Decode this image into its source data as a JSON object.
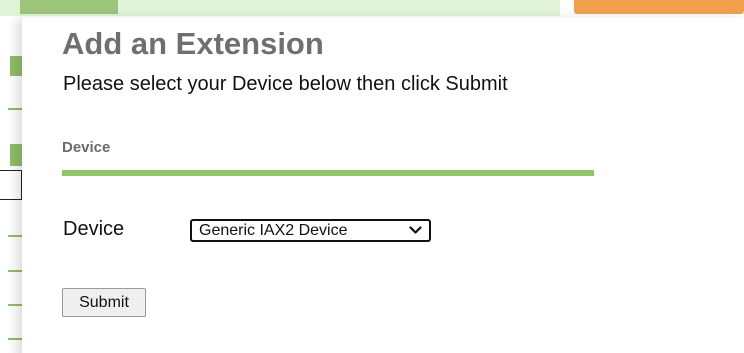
{
  "dialog": {
    "title": "Add an Extension",
    "subtitle": "Please select your Device below then click Submit",
    "section_label": "Device",
    "field_label": "Device",
    "device_select": {
      "selected": "Generic IAX2 Device"
    },
    "submit_label": "Submit"
  },
  "colors": {
    "accent_green": "#92c46e",
    "apply_orange": "#f0a04b",
    "title_gray": "#6f6f6f"
  }
}
